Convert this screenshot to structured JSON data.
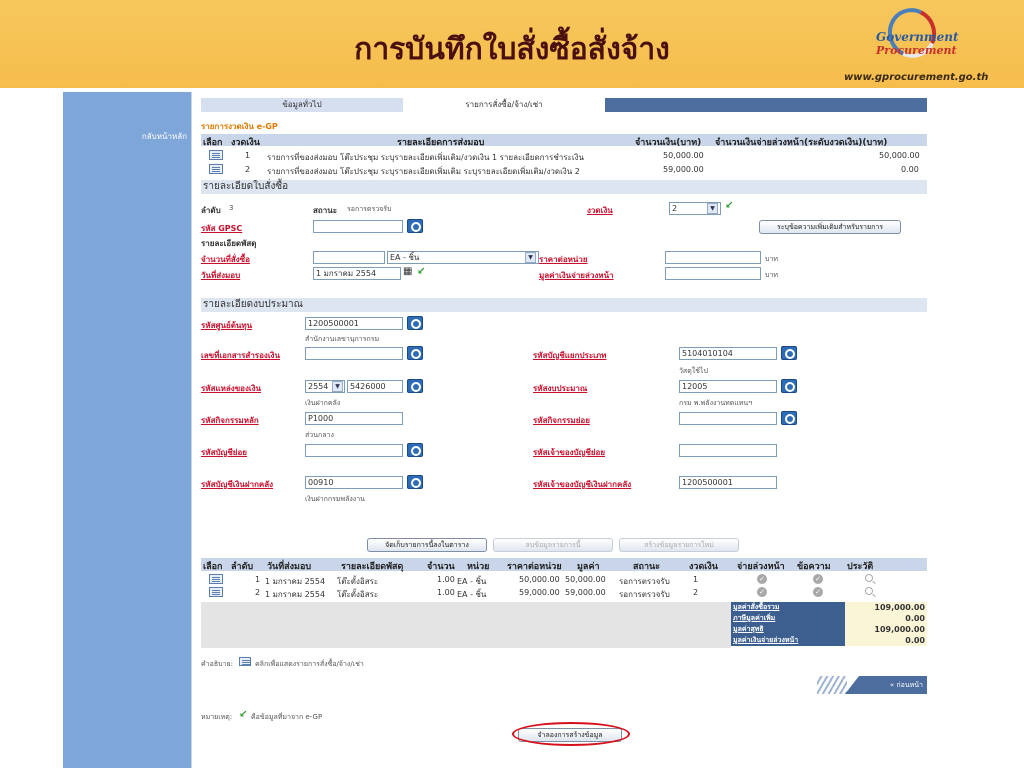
{
  "header": {
    "title": "การบันทึกใบสั่งซื้อสั่งจ้าง",
    "logo_line1": "Government",
    "logo_line2": "Procurement",
    "url": "www.gprocurement.go.th"
  },
  "sidebar": {
    "back_link": "กลับหน้าหลัก"
  },
  "tabs": [
    "ข้อมูลทั่วไป",
    "รายการสั่งซื้อ/จ้าง/เช่า"
  ],
  "installment": {
    "caption": "รายการงวดเงิน e-GP",
    "headers": [
      "เลือก",
      "งวดเงิน",
      "รายละเอียดการส่งมอบ",
      "จำนวนเงิน(บาท)",
      "จำนวนเงินจ่ายล่วงหน้า(ระดับงวดเงิน)(บาท)"
    ],
    "rows": [
      {
        "no": "1",
        "detail": "รายการที่ของส่งมอบ โต๊ะประชุม ระบุรายละเอียดเพิ่มเติม/งวดเงิน 1 รายละเอียดการชำระเงิน",
        "amount": "50,000.00",
        "advance": "50,000.00"
      },
      {
        "no": "2",
        "detail": "รายการที่ของส่งมอบ โต๊ะประชุม ระบุรายละเอียดเพิ่มเติม ระบุรายละเอียดเพิ่มเติม/งวดเงิน 2",
        "amount": "59,000.00",
        "advance": "0.00"
      }
    ]
  },
  "order_detail": {
    "section": "รายละเอียดใบสั่งซื้อ",
    "seq_label": "ลำดับ",
    "seq_value": "3",
    "status_label": "สถานะ",
    "status_value": "รอการตรวจรับ",
    "installment_label": "งวดเงิน",
    "installment_value": "2",
    "gpsc_label": "รหัส GPSC",
    "extra_btn": "ระบุข้อความเพิ่มเติมสำหรับรายการ",
    "item_detail_label": "รายละเอียดพัสดุ",
    "qty_label": "จำนวนที่สั่งซื้อ",
    "unit_value": "EA - ชิ้น",
    "unit_price_label": "ราคาต่อหน่วย",
    "baht": "บาท",
    "delivery_label": "วันที่ส่งมอบ",
    "delivery_value": "1 มกราคม 2554",
    "advance_label": "มูลค่าเงินจ่ายล่วงหน้า"
  },
  "budget": {
    "section": "รายละเอียดงบประมาณ",
    "cost_center_label": "รหัสศูนย์ต้นทุน",
    "cost_center_value": "1200500001",
    "cost_center_desc": "สำนักงานเลขานุการกรม",
    "reserve_doc_label": "เลขที่เอกสารสำรองเงิน",
    "gl_label": "รหัสบัญชีแยกประเภท",
    "gl_value": "5104010104",
    "gl_desc": "วัสดุใช้ไป",
    "fund_label": "รหัสแหล่งของเงิน",
    "fund_year": "2554",
    "fund_value": "5426000",
    "fund_desc": "เงินฝากคลัง",
    "budget_code_label": "รหัสงบประมาณ",
    "budget_code_value": "12005",
    "budget_code_desc": "กรม พ.พลังงานทดแทนฯ",
    "main_activity_label": "รหัสกิจกรรมหลัก",
    "main_activity_value": "P1000",
    "main_activity_desc": "ส่วนกลาง",
    "sub_activity_label": "รหัสกิจกรรมย่อย",
    "sub_account_label": "รหัสบัญชีย่อย",
    "sub_account_owner_label": "รหัสเจ้าของบัญชีย่อย",
    "deposit_account_label": "รหัสบัญชีเงินฝากคลัง",
    "deposit_account_value": "00910",
    "deposit_account_desc": "เงินฝากกรมพลังงาน",
    "deposit_owner_label": "รหัสเจ้าของบัญชีเงินฝากคลัง",
    "deposit_owner_value": "1200500001"
  },
  "actions": {
    "save": "จัดเก็บรายการนี้ลงในตาราง",
    "delete": "ลบข้อมูลรายการนี้",
    "new": "สร้างข้อมูลรายการใหม่"
  },
  "items": {
    "headers": [
      "เลือก",
      "ลำดับ",
      "วันที่ส่งมอบ",
      "รายละเอียดพัสดุ",
      "จำนวน",
      "หน่วย",
      "ราคาต่อหน่วย",
      "มูลค่า",
      "สถานะ",
      "งวดเงิน",
      "จ่ายล่วงหน้า",
      "ข้อความ",
      "ประวัติ"
    ],
    "rows": [
      {
        "seq": "1",
        "date": "1 มกราคม 2554",
        "detail": "โต๊ะตั้งอิสระ",
        "qty": "1.00",
        "unit": "EA - ชิ้น",
        "price": "50,000.00",
        "value": "50,000.00",
        "status": "รอการตรวจรับ",
        "inst": "1"
      },
      {
        "seq": "2",
        "date": "1 มกราคม 2554",
        "detail": "โต๊ะตั้งอิสระ",
        "qty": "1.00",
        "unit": "EA - ชิ้น",
        "price": "59,000.00",
        "value": "59,000.00",
        "status": "รอการตรวจรับ",
        "inst": "2"
      }
    ]
  },
  "summary": [
    {
      "label": "มูลค่าสั่งซื้อรวม",
      "value": "109,000.00"
    },
    {
      "label": "ภาษีมูลค่าเพิ่ม",
      "value": "0.00"
    },
    {
      "label": "มูลค่าสุทธิ",
      "value": "109,000.00"
    },
    {
      "label": "มูลค่าเงินจ่ายล่วงหน้า",
      "value": "0.00"
    }
  ],
  "legend": "คำอธิบาย:",
  "legend_text": "คลิกเพื่อแสดงรายการสั่งซื้อ/จ้าง/เช่า",
  "back_button": "« ก่อนหน้า",
  "note": "หมายเหตุ:",
  "note_text": "คือข้อมูลที่มาจาก e-GP",
  "simulate_button": "จำลองการสร้างข้อมูล"
}
